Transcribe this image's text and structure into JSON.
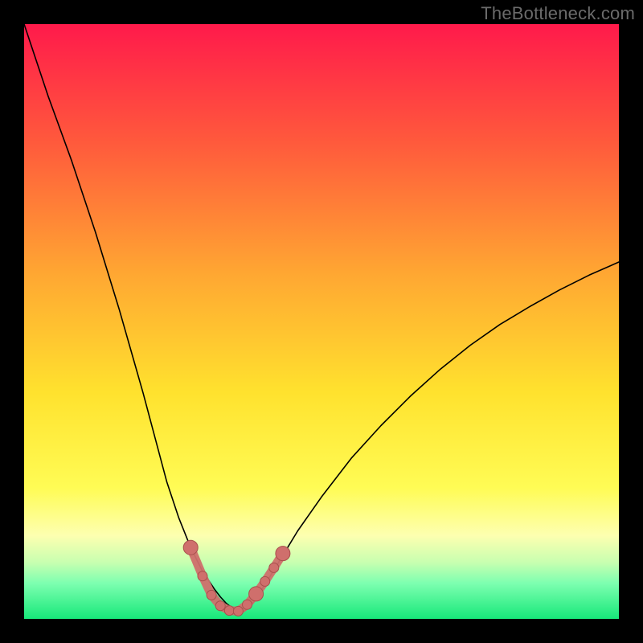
{
  "watermark": "TheBottleneck.com",
  "chart_data": {
    "type": "line",
    "title": "",
    "xlabel": "",
    "ylabel": "",
    "xlim": [
      0,
      100
    ],
    "ylim": [
      0,
      100
    ],
    "grid": false,
    "legend": false,
    "background_gradient": {
      "stops": [
        {
          "offset": 0.0,
          "color": "#ff1a4b"
        },
        {
          "offset": 0.2,
          "color": "#ff5a3c"
        },
        {
          "offset": 0.42,
          "color": "#ffa732"
        },
        {
          "offset": 0.62,
          "color": "#ffe22e"
        },
        {
          "offset": 0.78,
          "color": "#fffc55"
        },
        {
          "offset": 0.86,
          "color": "#fdffb0"
        },
        {
          "offset": 0.905,
          "color": "#c8ffb0"
        },
        {
          "offset": 0.94,
          "color": "#7dffb0"
        },
        {
          "offset": 1.0,
          "color": "#17e87a"
        }
      ]
    },
    "series": [
      {
        "name": "bottleneck-curve",
        "type": "line",
        "color": "#000000",
        "width": 1.6,
        "x": [
          0,
          2,
          4,
          6,
          8,
          10,
          12,
          14,
          16,
          18,
          20,
          22,
          24,
          26,
          28,
          30,
          31,
          32,
          33,
          34,
          35,
          36,
          37,
          38,
          39,
          40,
          42,
          44,
          46,
          50,
          55,
          60,
          65,
          70,
          75,
          80,
          85,
          90,
          95,
          100
        ],
        "y": [
          100,
          94,
          88,
          82.5,
          77,
          71,
          65,
          58.5,
          52,
          45,
          38,
          30.5,
          23,
          17,
          12,
          8,
          6.5,
          5,
          3.7,
          2.6,
          1.8,
          1.2,
          1.3,
          2.1,
          3.4,
          5,
          8.2,
          11.5,
          14.8,
          20.5,
          27,
          32.5,
          37.5,
          42,
          46,
          49.5,
          52.5,
          55.3,
          57.8,
          60
        ]
      },
      {
        "name": "bottleneck-markers",
        "type": "scatter",
        "color": "#cf6f6c",
        "outline": "#a84f4c",
        "radius_small": 6,
        "radius_large": 9,
        "points": [
          {
            "x": 28.0,
            "y": 12.0,
            "r": "large"
          },
          {
            "x": 30.0,
            "y": 7.2,
            "r": "small"
          },
          {
            "x": 31.5,
            "y": 4.0,
            "r": "small"
          },
          {
            "x": 33.0,
            "y": 2.2,
            "r": "small"
          },
          {
            "x": 34.5,
            "y": 1.4,
            "r": "small"
          },
          {
            "x": 36.0,
            "y": 1.3,
            "r": "small"
          },
          {
            "x": 37.5,
            "y": 2.4,
            "r": "small"
          },
          {
            "x": 39.0,
            "y": 4.2,
            "r": "large"
          },
          {
            "x": 40.5,
            "y": 6.3,
            "r": "small"
          },
          {
            "x": 42.0,
            "y": 8.6,
            "r": "small"
          },
          {
            "x": 43.5,
            "y": 11.0,
            "r": "large"
          }
        ]
      }
    ]
  }
}
